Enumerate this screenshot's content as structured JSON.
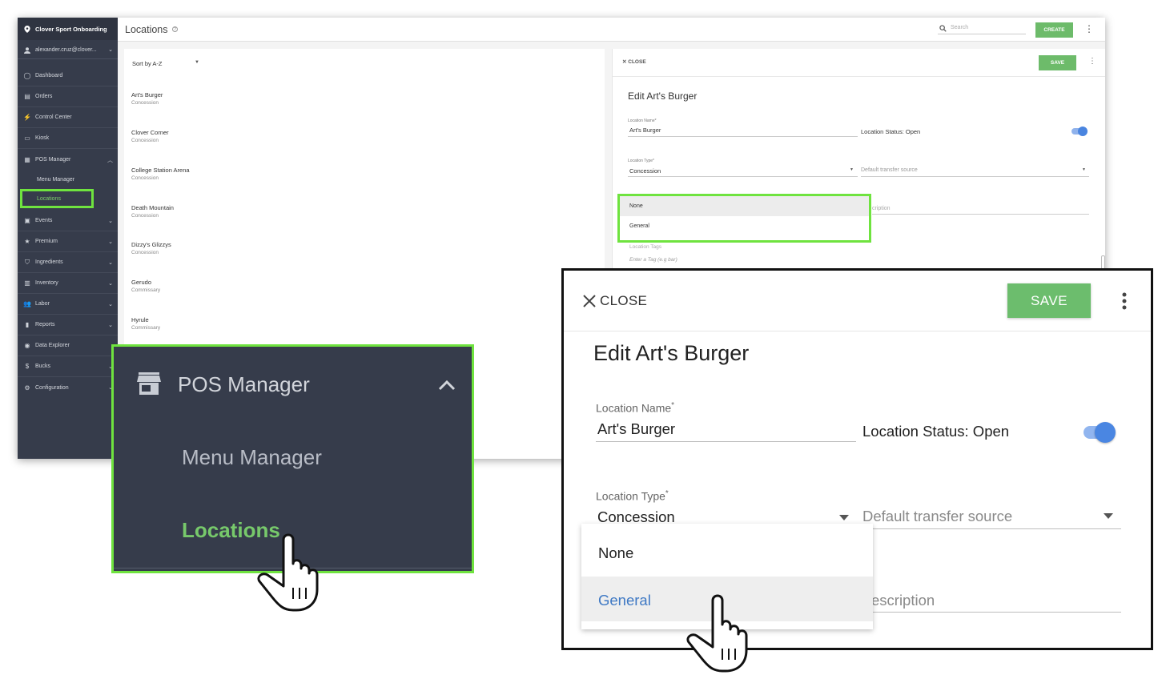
{
  "app": {
    "org_name": "Clover Sport Onboarding",
    "user_email": "alexander.cruz@clover...",
    "page_title": "Locations",
    "search_placeholder": "Search",
    "create_label": "CREATE"
  },
  "sidebar": {
    "items": [
      {
        "label": "Dashboard",
        "icon": "dashboard-icon"
      },
      {
        "label": "Orders",
        "icon": "orders-icon"
      },
      {
        "label": "Control Center",
        "icon": "control-center-icon"
      },
      {
        "label": "Kiosk",
        "icon": "kiosk-icon"
      },
      {
        "label": "POS Manager",
        "icon": "store-icon"
      },
      {
        "label": "Menu Manager"
      },
      {
        "label": "Locations"
      },
      {
        "label": "Events",
        "icon": "calendar-icon"
      },
      {
        "label": "Premium",
        "icon": "star-icon"
      },
      {
        "label": "Ingredients",
        "icon": "basket-icon"
      },
      {
        "label": "Inventory",
        "icon": "inventory-icon"
      },
      {
        "label": "Labor",
        "icon": "people-icon"
      },
      {
        "label": "Reports",
        "icon": "bar-chart-icon"
      },
      {
        "label": "Data Explorer",
        "icon": "explore-icon"
      },
      {
        "label": "Bucks",
        "icon": "dollar-icon"
      },
      {
        "label": "Configuration",
        "icon": "gear-icon"
      }
    ]
  },
  "list": {
    "sort_label": "Sort by A-Z",
    "rows": [
      {
        "name": "Art's Burger",
        "type": "Concession"
      },
      {
        "name": "Clover Corner",
        "type": "Concession"
      },
      {
        "name": "College Station Arena",
        "type": "Concession"
      },
      {
        "name": "Death Mountain",
        "type": "Concession"
      },
      {
        "name": "Dizzy's Glizzys",
        "type": "Concession"
      },
      {
        "name": "Gerudo",
        "type": "Commissary"
      },
      {
        "name": "Hyrule",
        "type": "Commissary"
      }
    ]
  },
  "edit": {
    "close_label": "CLOSE",
    "save_label": "SAVE",
    "title": "Edit Art's Burger",
    "location_name_label": "Location Name",
    "required_mark": "*",
    "location_name_value": "Art's Burger",
    "status_label": "Location Status: Open",
    "location_type_label": "Location Type",
    "location_type_value": "Concession",
    "transfer_placeholder": "Default transfer source",
    "description_placeholder": "Description",
    "description_visible_small": "cription",
    "description_visible_large": "escription",
    "tags_label": "Location Tags",
    "tags_placeholder": "Enter a Tag (e.g bar)",
    "dropdown_options": [
      "None",
      "General"
    ],
    "highlighted_option": "General"
  },
  "zoom_sidebar": {
    "pos_manager": "POS Manager",
    "menu_manager": "Menu Manager",
    "locations": "Locations"
  },
  "colors": {
    "sidebar_bg": "#363c4b",
    "accent_green": "#6dbb6a",
    "highlight_green": "#6fe33f",
    "active_link": "#77c96b",
    "toggle_blue": "#4a86e2",
    "option_blue": "#3f79c4"
  }
}
